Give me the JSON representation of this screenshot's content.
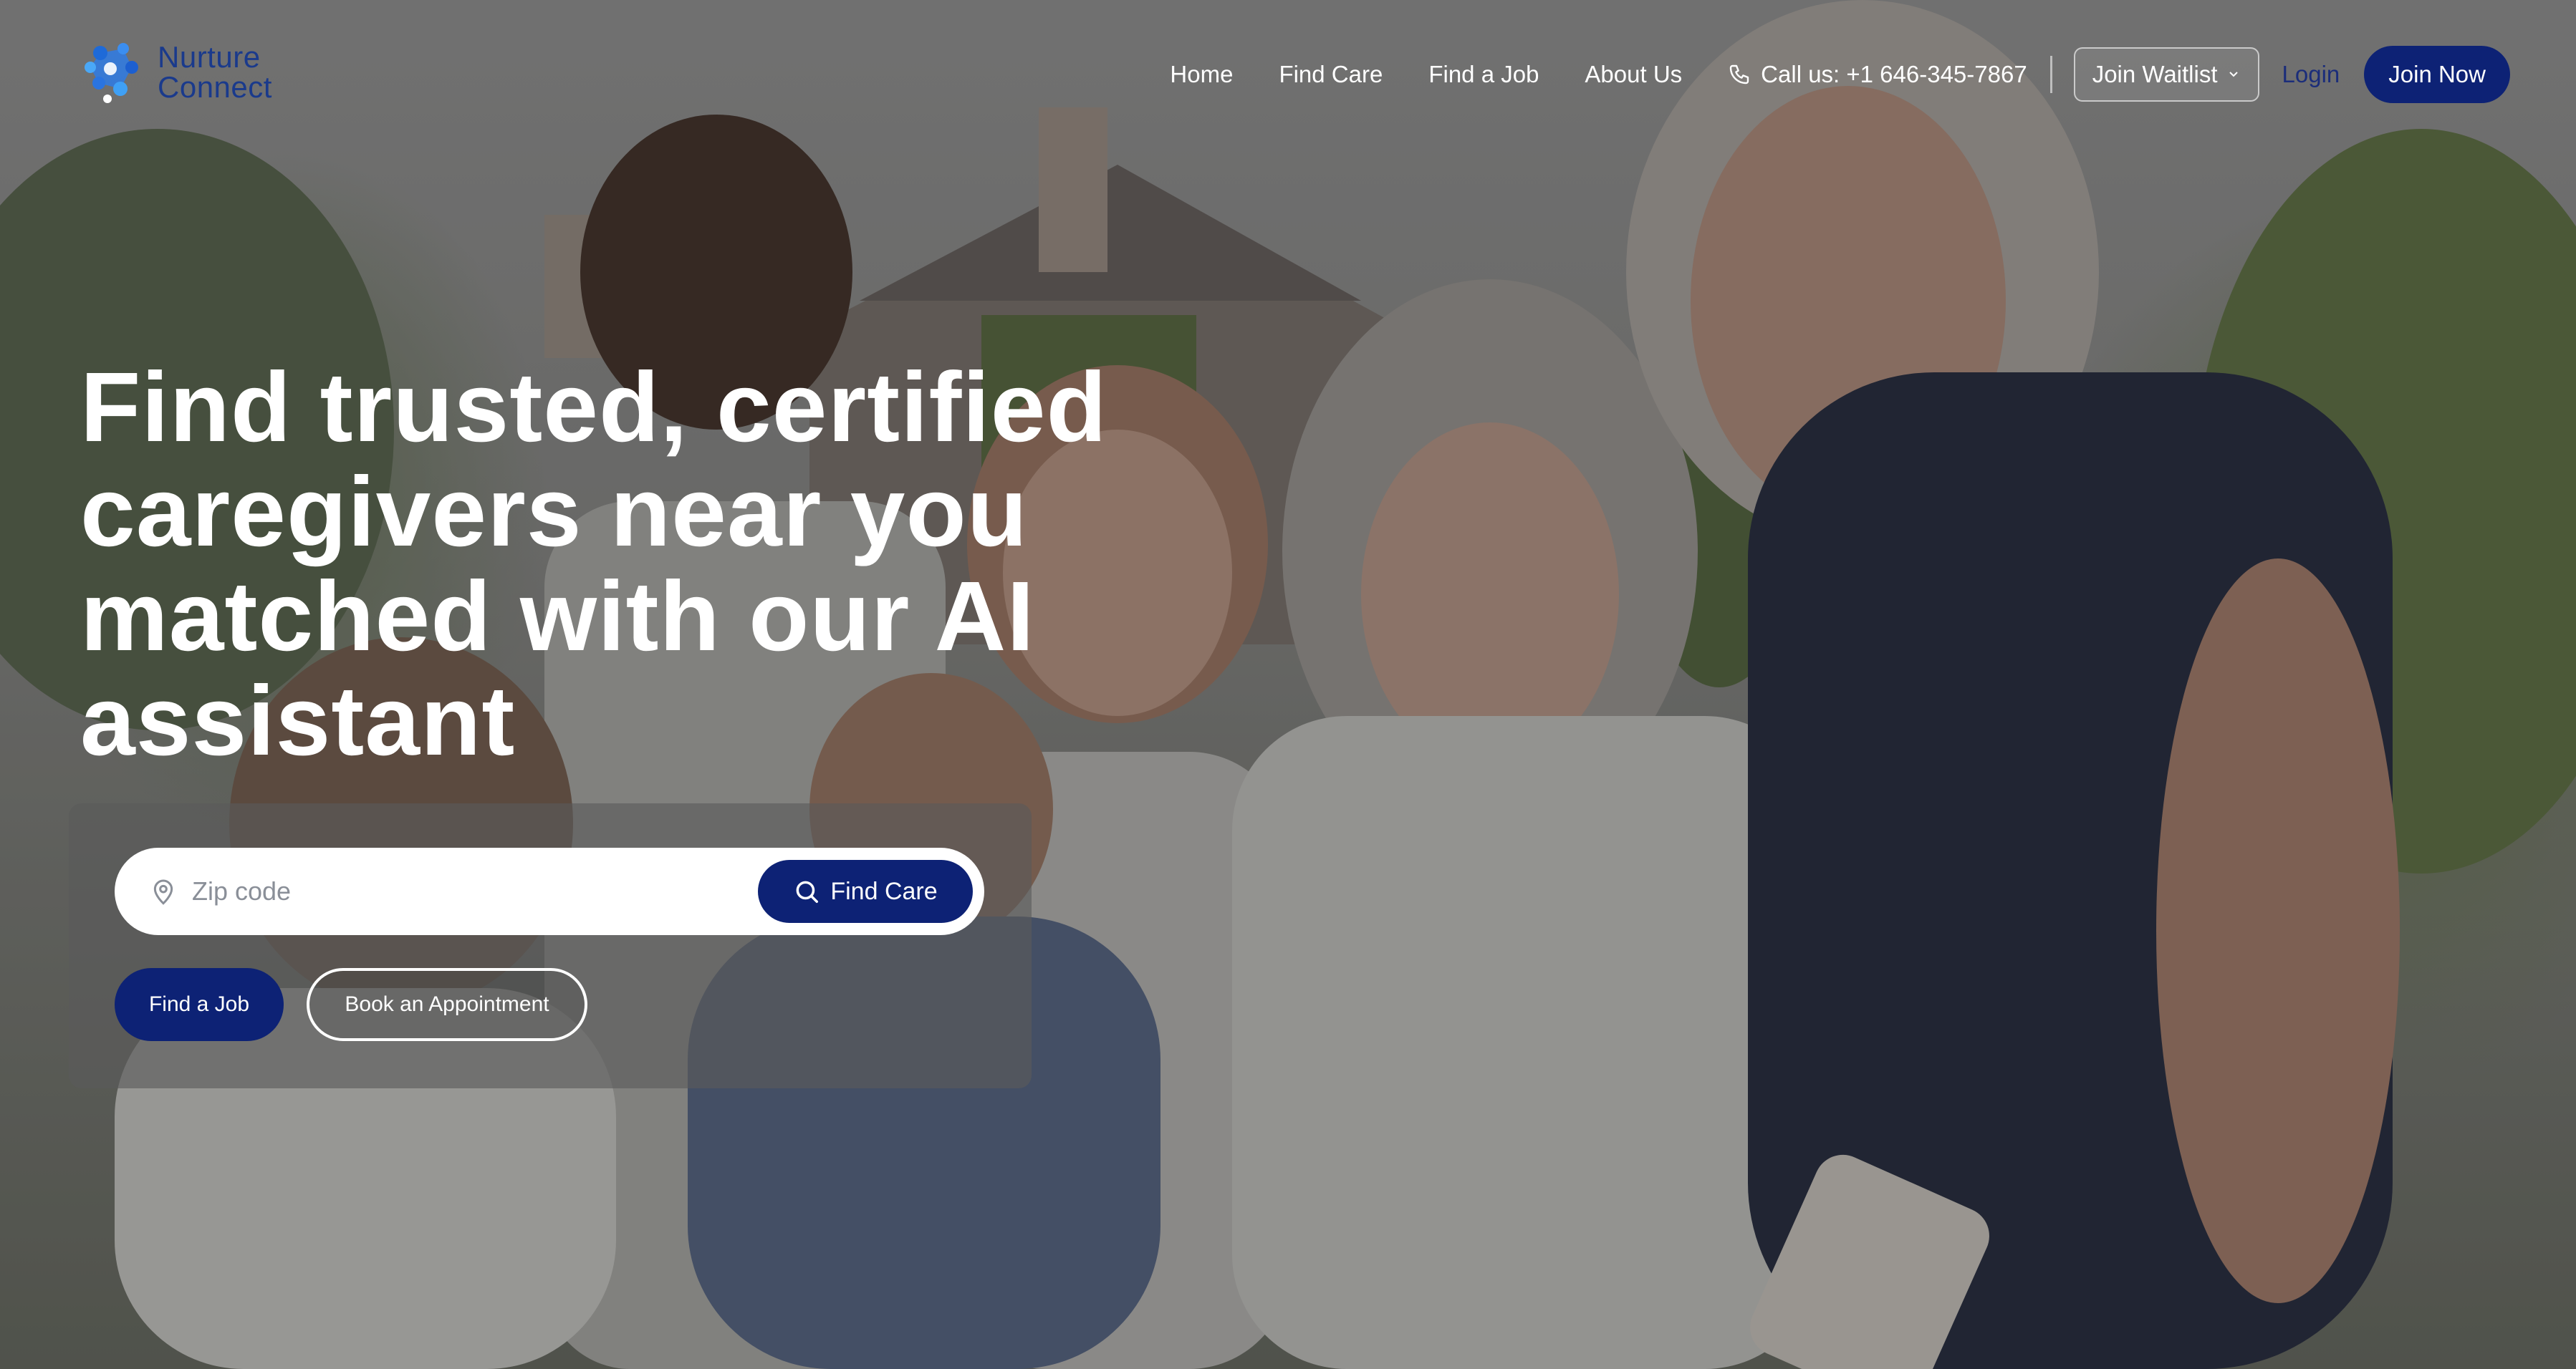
{
  "brand": {
    "name_line1": "Nurture",
    "name_line2": "Connect",
    "logo_icon": "nurture-connect-logo-icon",
    "color": "#1a3a8c"
  },
  "nav": {
    "links": [
      "Home",
      "Find Care",
      "Find a Job",
      "About Us"
    ],
    "call_icon": "phone-icon",
    "call_label": "Call us: +1 646-345-7867",
    "waitlist_label": "Join Waitlist",
    "waitlist_icon": "chevron-down-icon",
    "login_label": "Login",
    "join_label": "Join Now"
  },
  "hero": {
    "headline": "Find trusted, certified caregivers near you matched with our AI assistant",
    "background_image": "family-group-photo"
  },
  "search": {
    "pin_icon": "map-pin-icon",
    "placeholder": "Zip code",
    "value": "",
    "button_icon": "search-icon",
    "button_label": "Find Care"
  },
  "actions": {
    "find_job_label": "Find a Job",
    "book_label": "Book an Appointment"
  },
  "colors": {
    "primary": "#0d2275",
    "white": "#ffffff"
  }
}
